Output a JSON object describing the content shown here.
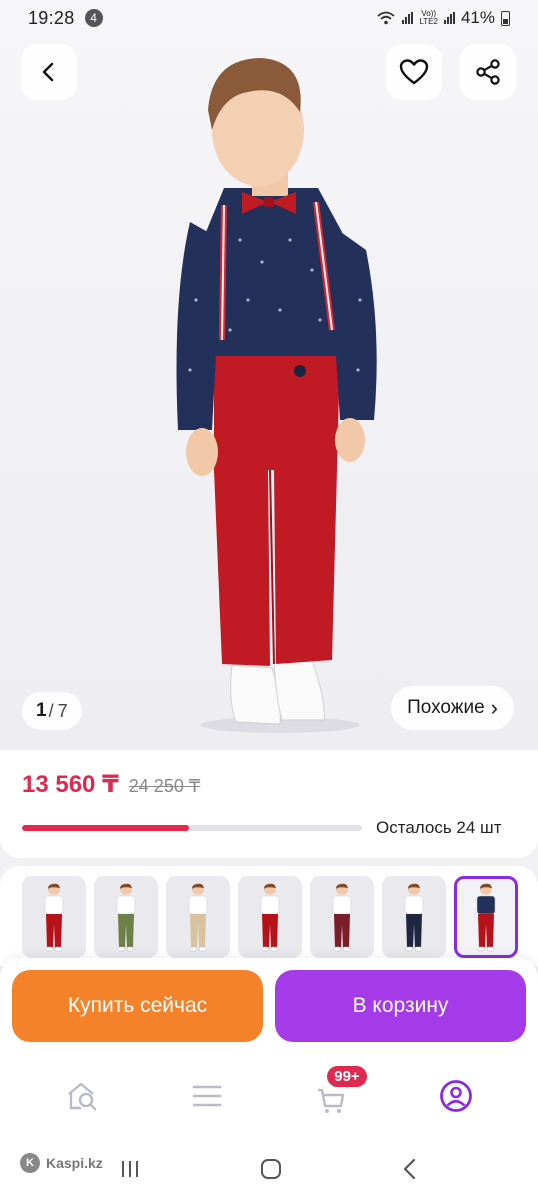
{
  "status_bar": {
    "time": "19:28",
    "notification_count": "4",
    "network": "LTE2",
    "volte": "Vo))",
    "battery": "41%"
  },
  "gallery": {
    "current": "1",
    "separator": "/",
    "total": "7",
    "similar_label": "Похожие",
    "similar_chevron": "›"
  },
  "price": {
    "current": "13 560 ₸",
    "old": "24 250 ₸",
    "stock_label": "Осталось 24 шт",
    "stock_progress_percent": 49
  },
  "thumbnails": [
    {
      "pants_color": "#b5121b",
      "shirt_color": "#ffffff",
      "active": false
    },
    {
      "pants_color": "#6f7f4a",
      "shirt_color": "#ffffff",
      "active": false
    },
    {
      "pants_color": "#d8c2a0",
      "shirt_color": "#ffffff",
      "active": false
    },
    {
      "pants_color": "#b5121b",
      "shirt_color": "#ffffff",
      "active": false
    },
    {
      "pants_color": "#7a1e2a",
      "shirt_color": "#ffffff",
      "active": false
    },
    {
      "pants_color": "#1f2740",
      "shirt_color": "#ffffff",
      "active": false
    },
    {
      "pants_color": "#b5121b",
      "shirt_color": "#23305a",
      "active": true
    }
  ],
  "actions": {
    "buy_now": "Купить сейчас",
    "add_to_cart": "В корзину"
  },
  "bottom_nav": {
    "cart_badge": "99+"
  },
  "watermark": {
    "text": "Kaspi.kz"
  },
  "colors": {
    "accent_red": "#e0294f",
    "buy_orange": "#f4822a",
    "cart_purple": "#a43ae8",
    "active_nav": "#8a2be2"
  }
}
